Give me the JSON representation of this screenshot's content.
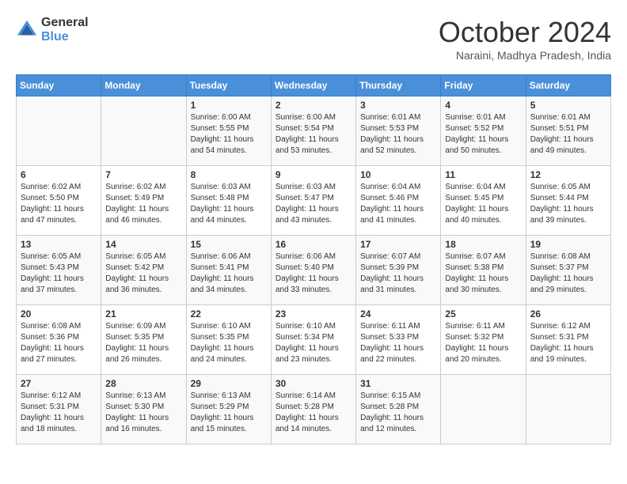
{
  "header": {
    "logo_general": "General",
    "logo_blue": "Blue",
    "month_title": "October 2024",
    "location": "Naraini, Madhya Pradesh, India"
  },
  "days_of_week": [
    "Sunday",
    "Monday",
    "Tuesday",
    "Wednesday",
    "Thursday",
    "Friday",
    "Saturday"
  ],
  "weeks": [
    [
      {
        "day": "",
        "info": ""
      },
      {
        "day": "",
        "info": ""
      },
      {
        "day": "1",
        "info": "Sunrise: 6:00 AM\nSunset: 5:55 PM\nDaylight: 11 hours and 54 minutes."
      },
      {
        "day": "2",
        "info": "Sunrise: 6:00 AM\nSunset: 5:54 PM\nDaylight: 11 hours and 53 minutes."
      },
      {
        "day": "3",
        "info": "Sunrise: 6:01 AM\nSunset: 5:53 PM\nDaylight: 11 hours and 52 minutes."
      },
      {
        "day": "4",
        "info": "Sunrise: 6:01 AM\nSunset: 5:52 PM\nDaylight: 11 hours and 50 minutes."
      },
      {
        "day": "5",
        "info": "Sunrise: 6:01 AM\nSunset: 5:51 PM\nDaylight: 11 hours and 49 minutes."
      }
    ],
    [
      {
        "day": "6",
        "info": "Sunrise: 6:02 AM\nSunset: 5:50 PM\nDaylight: 11 hours and 47 minutes."
      },
      {
        "day": "7",
        "info": "Sunrise: 6:02 AM\nSunset: 5:49 PM\nDaylight: 11 hours and 46 minutes."
      },
      {
        "day": "8",
        "info": "Sunrise: 6:03 AM\nSunset: 5:48 PM\nDaylight: 11 hours and 44 minutes."
      },
      {
        "day": "9",
        "info": "Sunrise: 6:03 AM\nSunset: 5:47 PM\nDaylight: 11 hours and 43 minutes."
      },
      {
        "day": "10",
        "info": "Sunrise: 6:04 AM\nSunset: 5:46 PM\nDaylight: 11 hours and 41 minutes."
      },
      {
        "day": "11",
        "info": "Sunrise: 6:04 AM\nSunset: 5:45 PM\nDaylight: 11 hours and 40 minutes."
      },
      {
        "day": "12",
        "info": "Sunrise: 6:05 AM\nSunset: 5:44 PM\nDaylight: 11 hours and 39 minutes."
      }
    ],
    [
      {
        "day": "13",
        "info": "Sunrise: 6:05 AM\nSunset: 5:43 PM\nDaylight: 11 hours and 37 minutes."
      },
      {
        "day": "14",
        "info": "Sunrise: 6:05 AM\nSunset: 5:42 PM\nDaylight: 11 hours and 36 minutes."
      },
      {
        "day": "15",
        "info": "Sunrise: 6:06 AM\nSunset: 5:41 PM\nDaylight: 11 hours and 34 minutes."
      },
      {
        "day": "16",
        "info": "Sunrise: 6:06 AM\nSunset: 5:40 PM\nDaylight: 11 hours and 33 minutes."
      },
      {
        "day": "17",
        "info": "Sunrise: 6:07 AM\nSunset: 5:39 PM\nDaylight: 11 hours and 31 minutes."
      },
      {
        "day": "18",
        "info": "Sunrise: 6:07 AM\nSunset: 5:38 PM\nDaylight: 11 hours and 30 minutes."
      },
      {
        "day": "19",
        "info": "Sunrise: 6:08 AM\nSunset: 5:37 PM\nDaylight: 11 hours and 29 minutes."
      }
    ],
    [
      {
        "day": "20",
        "info": "Sunrise: 6:08 AM\nSunset: 5:36 PM\nDaylight: 11 hours and 27 minutes."
      },
      {
        "day": "21",
        "info": "Sunrise: 6:09 AM\nSunset: 5:35 PM\nDaylight: 11 hours and 26 minutes."
      },
      {
        "day": "22",
        "info": "Sunrise: 6:10 AM\nSunset: 5:35 PM\nDaylight: 11 hours and 24 minutes."
      },
      {
        "day": "23",
        "info": "Sunrise: 6:10 AM\nSunset: 5:34 PM\nDaylight: 11 hours and 23 minutes."
      },
      {
        "day": "24",
        "info": "Sunrise: 6:11 AM\nSunset: 5:33 PM\nDaylight: 11 hours and 22 minutes."
      },
      {
        "day": "25",
        "info": "Sunrise: 6:11 AM\nSunset: 5:32 PM\nDaylight: 11 hours and 20 minutes."
      },
      {
        "day": "26",
        "info": "Sunrise: 6:12 AM\nSunset: 5:31 PM\nDaylight: 11 hours and 19 minutes."
      }
    ],
    [
      {
        "day": "27",
        "info": "Sunrise: 6:12 AM\nSunset: 5:31 PM\nDaylight: 11 hours and 18 minutes."
      },
      {
        "day": "28",
        "info": "Sunrise: 6:13 AM\nSunset: 5:30 PM\nDaylight: 11 hours and 16 minutes."
      },
      {
        "day": "29",
        "info": "Sunrise: 6:13 AM\nSunset: 5:29 PM\nDaylight: 11 hours and 15 minutes."
      },
      {
        "day": "30",
        "info": "Sunrise: 6:14 AM\nSunset: 5:28 PM\nDaylight: 11 hours and 14 minutes."
      },
      {
        "day": "31",
        "info": "Sunrise: 6:15 AM\nSunset: 5:28 PM\nDaylight: 11 hours and 12 minutes."
      },
      {
        "day": "",
        "info": ""
      },
      {
        "day": "",
        "info": ""
      }
    ]
  ]
}
